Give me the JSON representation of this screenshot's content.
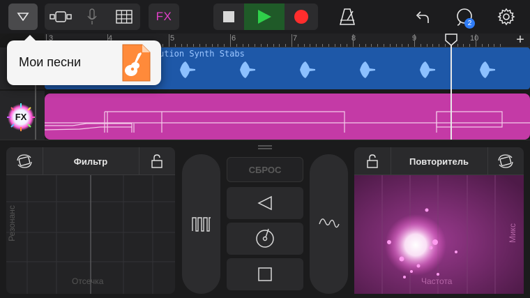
{
  "toolbar": {
    "fx_label": "FX",
    "notification_count": "2"
  },
  "ruler": {
    "labels": [
      "3",
      "4",
      "5",
      "6",
      "7",
      "8",
      "9",
      "10"
    ]
  },
  "tracks": {
    "blue_region_title": "ution Synth Stabs",
    "fx_label": "FX"
  },
  "popup": {
    "label": "Мои песни"
  },
  "filter_panel": {
    "title": "Фильтр",
    "x_label": "Отсечка",
    "y_label": "Резонанс"
  },
  "center": {
    "reset_label": "СБРОС"
  },
  "repeater_panel": {
    "title": "Повторитель",
    "x_label": "Частота",
    "y_label": "Микс"
  },
  "colors": {
    "accent_fx": "#e040c8",
    "play_green": "#2fd04a",
    "record_red": "#ff2d2d",
    "track_blue": "#1e58a8",
    "track_pink": "#c43aa6",
    "badge_blue": "#2f7cf6"
  }
}
